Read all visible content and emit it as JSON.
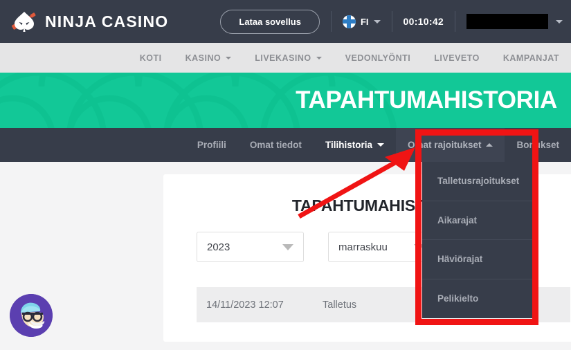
{
  "header": {
    "brand": "NINJA CASINO",
    "download_button": "Lataa sovellus",
    "language": "FI",
    "timer": "00:10:42",
    "account_masked": ""
  },
  "main_nav": {
    "items": [
      {
        "label": "KOTI",
        "has_caret": false
      },
      {
        "label": "KASINO",
        "has_caret": true
      },
      {
        "label": "LIVEKASINO",
        "has_caret": true
      },
      {
        "label": "VEDONLYÖNTI",
        "has_caret": false
      },
      {
        "label": "LIVEVETO",
        "has_caret": false
      },
      {
        "label": "KAMPANJAT",
        "has_caret": false
      }
    ]
  },
  "hero": {
    "title": "TAPAHTUMAHISTORIA"
  },
  "sub_nav": {
    "items": [
      {
        "label": "Profiili"
      },
      {
        "label": "Omat tiedot"
      },
      {
        "label": "Tilihistoria"
      },
      {
        "label": "Omat rajoitukset"
      },
      {
        "label": "Bonukset"
      }
    ]
  },
  "dropdown": {
    "items": [
      {
        "label": "Talletusrajoitukset"
      },
      {
        "label": "Aikarajat"
      },
      {
        "label": "Häviörajat"
      },
      {
        "label": "Pelikielto"
      }
    ]
  },
  "content": {
    "title": "TAPAHTUMAHISTORIA",
    "year_select": "2023",
    "month_select": "marraskuu",
    "transactions": [
      {
        "date": "14/11/2023 12:07",
        "type": "Talletus"
      }
    ]
  },
  "colors": {
    "brand_green": "#12c897",
    "dark_navy": "#373d4a",
    "annotation_red": "#f01414",
    "chat_purple": "#5b3fb0"
  }
}
